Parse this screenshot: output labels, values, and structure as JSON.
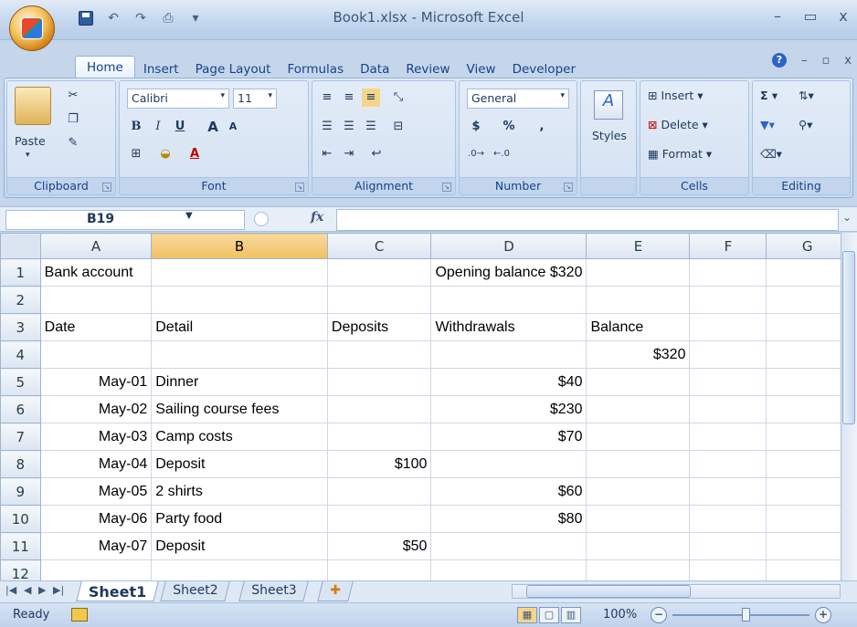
{
  "window": {
    "title": "Book1.xlsx - Microsoft Excel"
  },
  "ribbon": {
    "tabs": [
      "Home",
      "Insert",
      "Page Layout",
      "Formulas",
      "Data",
      "Review",
      "View",
      "Developer"
    ],
    "clipboard": {
      "label": "Clipboard",
      "paste": "Paste"
    },
    "font": {
      "label": "Font",
      "name": "Calibri",
      "size": "11",
      "bold": "B",
      "italic": "I",
      "underline": "U",
      "grow": "A",
      "shrink": "A",
      "color": "A"
    },
    "alignment": {
      "label": "Alignment"
    },
    "number": {
      "label": "Number",
      "format": "General",
      "currency": "$",
      "percent": "%",
      "comma": ","
    },
    "styles": {
      "label": "Styles"
    },
    "cells": {
      "label": "Cells",
      "insert": "Insert",
      "delete": "Delete",
      "format": "Format"
    },
    "editing": {
      "label": "Editing",
      "sum": "Σ"
    }
  },
  "formula_bar": {
    "name_box": "B19",
    "fx": "fx",
    "value": ""
  },
  "sheet": {
    "columns": [
      "A",
      "B",
      "C",
      "D",
      "E",
      "F",
      "G"
    ],
    "selected_column": "B",
    "rows": [
      {
        "n": "1",
        "A": "Bank account",
        "B": "",
        "C": "",
        "D": "Opening balance $320",
        "E": "",
        "F": "",
        "G": ""
      },
      {
        "n": "2",
        "A": "",
        "B": "",
        "C": "",
        "D": "",
        "E": "",
        "F": "",
        "G": ""
      },
      {
        "n": "3",
        "A": "Date",
        "B": "Detail",
        "C": "Deposits",
        "D": "Withdrawals",
        "E": "Balance",
        "F": "",
        "G": ""
      },
      {
        "n": "4",
        "A": "",
        "B": "",
        "C": "",
        "D": "",
        "E": "$320",
        "F": "",
        "G": ""
      },
      {
        "n": "5",
        "A": "May-01",
        "B": "Dinner",
        "C": "",
        "D": "$40",
        "E": "",
        "F": "",
        "G": ""
      },
      {
        "n": "6",
        "A": "May-02",
        "B": "Sailing course fees",
        "C": "",
        "D": "$230",
        "E": "",
        "F": "",
        "G": ""
      },
      {
        "n": "7",
        "A": "May-03",
        "B": "Camp costs",
        "C": "",
        "D": "$70",
        "E": "",
        "F": "",
        "G": ""
      },
      {
        "n": "8",
        "A": "May-04",
        "B": "Deposit",
        "C": "$100",
        "D": "",
        "E": "",
        "F": "",
        "G": ""
      },
      {
        "n": "9",
        "A": "May-05",
        "B": "2 shirts",
        "C": "",
        "D": "$60",
        "E": "",
        "F": "",
        "G": ""
      },
      {
        "n": "10",
        "A": "May-06",
        "B": "Party food",
        "C": "",
        "D": "$80",
        "E": "",
        "F": "",
        "G": ""
      },
      {
        "n": "11",
        "A": "May-07",
        "B": "Deposit",
        "C": "$50",
        "D": "",
        "E": "",
        "F": "",
        "G": ""
      },
      {
        "n": "12",
        "A": "",
        "B": "",
        "C": "",
        "D": "",
        "E": "",
        "F": "",
        "G": ""
      }
    ],
    "right_aligned_columns": [
      "A",
      "C",
      "D",
      "E"
    ]
  },
  "sheet_tabs": [
    "Sheet1",
    "Sheet2",
    "Sheet3"
  ],
  "status_bar": {
    "state": "Ready",
    "zoom": "100%"
  }
}
